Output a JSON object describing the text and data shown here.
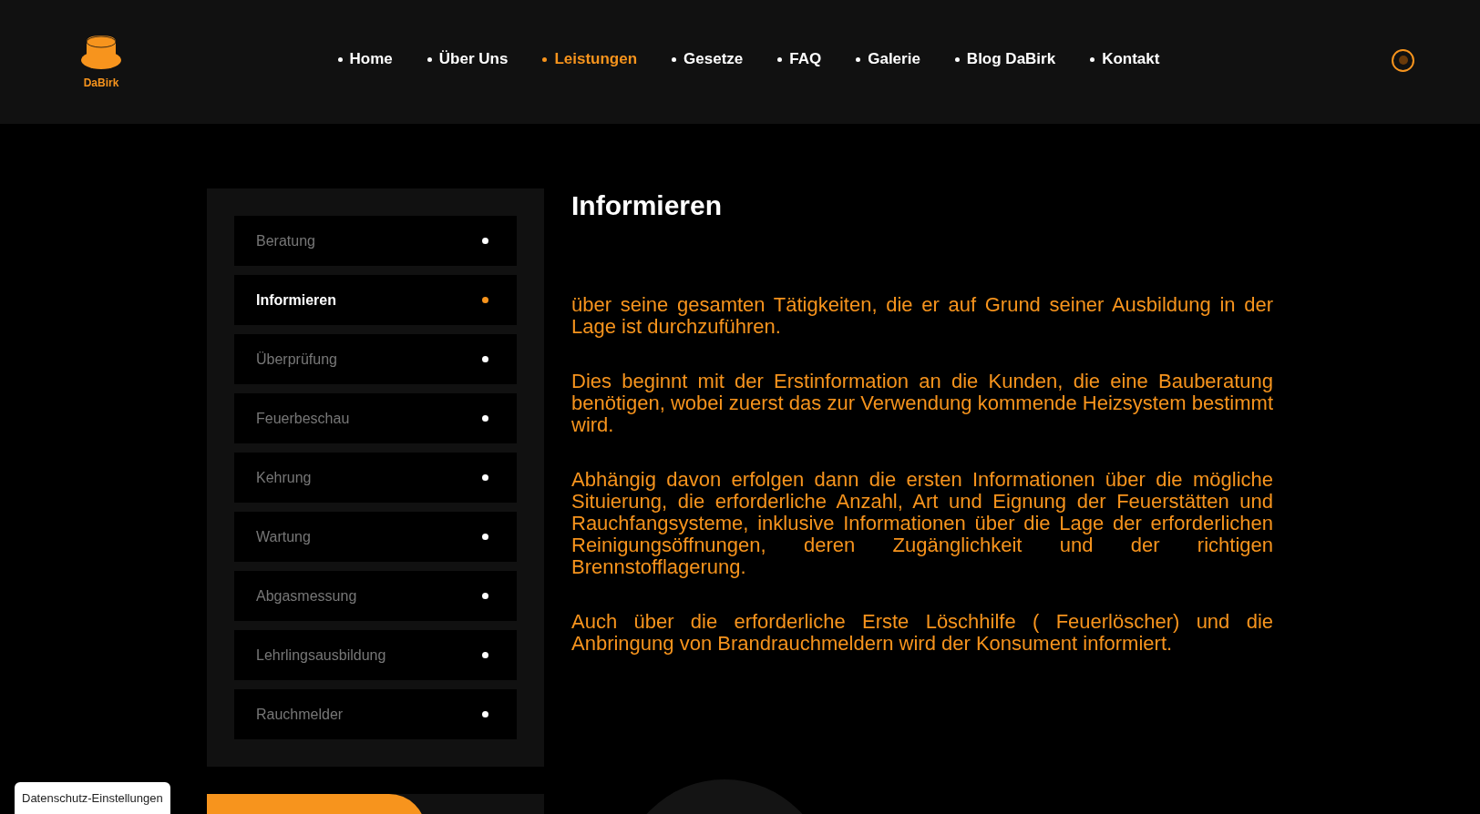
{
  "header": {
    "logo_text": "DaBirk",
    "nav": [
      {
        "label": "Home",
        "selected": false
      },
      {
        "label": "Über Uns",
        "selected": false
      },
      {
        "label": "Leistungen",
        "selected": true
      },
      {
        "label": "Gesetze",
        "selected": false
      },
      {
        "label": "FAQ",
        "selected": false
      },
      {
        "label": "Galerie",
        "selected": false
      },
      {
        "label": "Blog DaBirk",
        "selected": false
      },
      {
        "label": "Kontakt",
        "selected": false
      }
    ]
  },
  "sidebar": {
    "items": [
      {
        "label": "Beratung",
        "selected": false
      },
      {
        "label": "Informieren",
        "selected": true
      },
      {
        "label": "Überprüfung",
        "selected": false
      },
      {
        "label": "Feuerbeschau",
        "selected": false
      },
      {
        "label": "Kehrung",
        "selected": false
      },
      {
        "label": "Wartung",
        "selected": false
      },
      {
        "label": "Abgasmessung",
        "selected": false
      },
      {
        "label": "Lehrlingsausbildung",
        "selected": false
      },
      {
        "label": "Rauchmelder",
        "selected": false
      }
    ]
  },
  "content": {
    "title": "Informieren",
    "paragraphs": [
      "über seine gesamten Tätigkeiten, die er auf Grund seiner Ausbildung in der Lage ist durchzuführen.",
      "Dies beginnt mit der Erstinformation an die Kunden, die eine Bauberatung benötigen, wobei zuerst das zur Verwendung kommende Heizsystem bestimmt wird.",
      "Abhängig davon erfolgen dann die ersten Informationen über die mögliche Situierung, die erforderliche Anzahl, Art und Eignung der Feuerstätten und Rauchfangsysteme, inklusive Informationen über die Lage der erforderlichen Reinigungsöffnungen, deren Zugänglichkeit und der richtigen Brennstofflagerung.",
      "Auch über die erforderliche Erste Löschhilfe ( Feuerlöscher) und die Anbringung von Brandrauchmeldern wird der Konsument informiert."
    ]
  },
  "privacy_button": "Datenschutz-Einstellungen"
}
